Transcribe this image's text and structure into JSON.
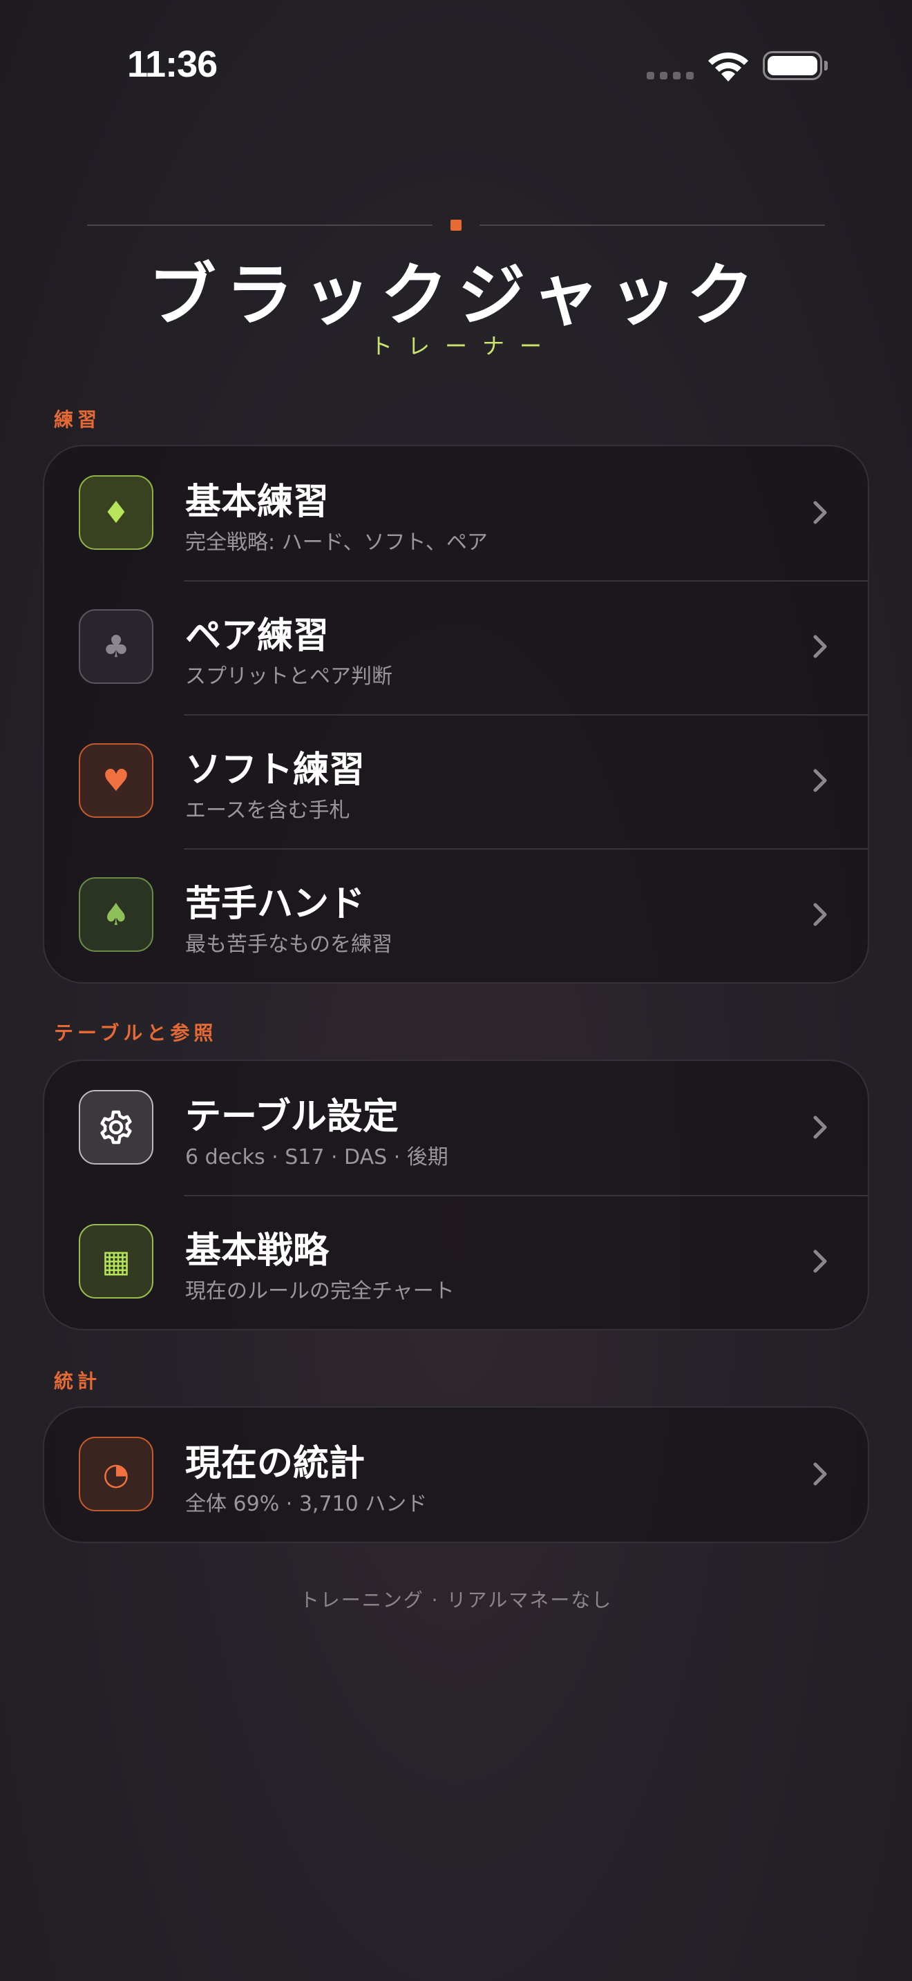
{
  "status": {
    "time": "11:36"
  },
  "header": {
    "title": "ブラックジャック",
    "subtitle": "トレーナー",
    "accent_color": "#e56a34"
  },
  "sections": {
    "practice": {
      "label": "練習",
      "items": [
        {
          "title": "基本練習",
          "subtitle": "完全戦略: ハード、ソフト、ペア",
          "icon": "diamond-icon",
          "glyph": "♦"
        },
        {
          "title": "ペア練習",
          "subtitle": "スプリットとペア判断",
          "icon": "club-icon",
          "glyph": "♣"
        },
        {
          "title": "ソフト練習",
          "subtitle": "エースを含む手札",
          "icon": "heart-icon",
          "glyph": "♥"
        },
        {
          "title": "苦手ハンド",
          "subtitle": "最も苦手なものを練習",
          "icon": "spade-icon",
          "glyph": "♠"
        }
      ]
    },
    "tables": {
      "label": "テーブルと参照",
      "items": [
        {
          "title": "テーブル設定",
          "subtitle": "6 decks · S17 · DAS · 後期",
          "icon": "gear-icon"
        },
        {
          "title": "基本戦略",
          "subtitle": "現在のルールの完全チャート",
          "icon": "grid-icon",
          "glyph": "▦"
        }
      ]
    },
    "stats": {
      "label": "統計",
      "items": [
        {
          "title": "現在の統計",
          "subtitle": "全体 69% · 3,710 ハンド",
          "icon": "pie-chart-icon",
          "glyph": "◔"
        }
      ]
    }
  },
  "footer": {
    "text": "トレーニング · リアルマネーなし"
  }
}
